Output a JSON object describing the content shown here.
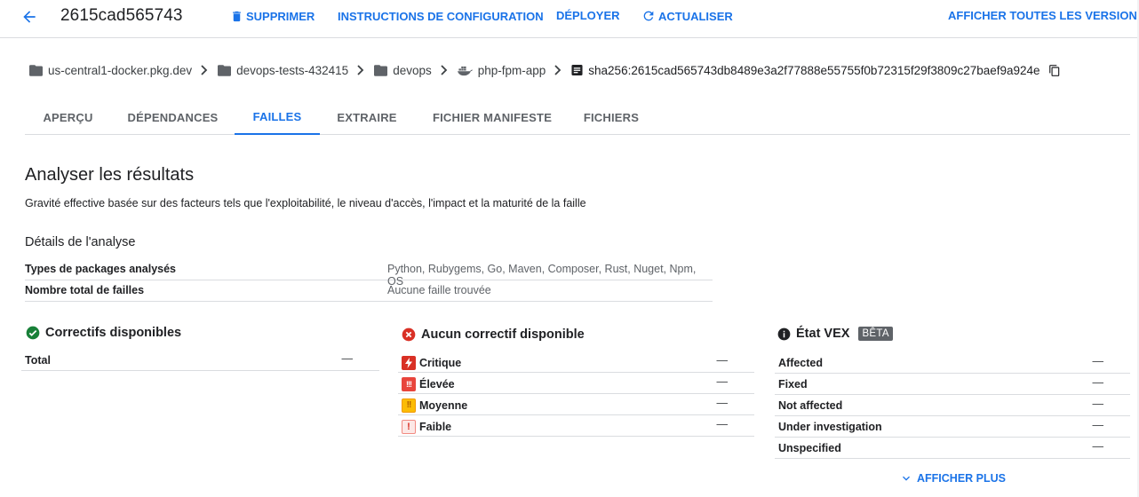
{
  "header": {
    "title": "2615cad565743",
    "delete_label": "SUPPRIMER",
    "setup_label": "INSTRUCTIONS DE CONFIGURATION",
    "deploy_label": "DÉPLOYER",
    "refresh_label": "ACTUALISER",
    "all_versions_label": "AFFICHER TOUTES LES VERSIONS",
    "accent_color": "#1a73e8"
  },
  "breadcrumb": {
    "items": [
      {
        "label": "us-central1-docker.pkg.dev",
        "icon": "folder-icon"
      },
      {
        "label": "devops-tests-432415",
        "icon": "folder-icon"
      },
      {
        "label": "devops",
        "icon": "folder-icon"
      },
      {
        "label": "php-fpm-app",
        "icon": "docker-icon"
      }
    ],
    "digest": "sha256:2615cad565743db8489e3a2f77888e55755f0b72315f29f3809c27baef9a924e"
  },
  "tabs": [
    {
      "label": "APERÇU",
      "active": false
    },
    {
      "label": "DÉPENDANCES",
      "active": false
    },
    {
      "label": "FAILLES",
      "active": true
    },
    {
      "label": "EXTRAIRE",
      "active": false
    },
    {
      "label": "FICHIER MANIFESTE",
      "active": false
    },
    {
      "label": "FICHIERS",
      "active": false
    }
  ],
  "analysis": {
    "title": "Analyser les résultats",
    "description": "Gravité effective basée sur des facteurs tels que l'exploitabilité, le niveau d'accès, l'impact et la maturité de la faille",
    "details_title": "Détails de l'analyse",
    "rows": [
      {
        "label": "Types de packages analysés",
        "value": "Python, Rubygems, Go, Maven, Composer, Rust, Nuget, Npm, OS"
      },
      {
        "label": "Nombre total de failles",
        "value": "Aucune faille trouvée"
      }
    ]
  },
  "fixes": {
    "title": "Correctifs disponibles",
    "rows": [
      {
        "label": "Total",
        "value": "—"
      }
    ]
  },
  "no_fix": {
    "title": "Aucun correctif disponible",
    "rows": [
      {
        "label": "Critique",
        "value": "—",
        "icon": "critical-icon",
        "color": "#d93025"
      },
      {
        "label": "Élevée",
        "value": "—",
        "icon": "high-icon",
        "color": "#e8453c"
      },
      {
        "label": "Moyenne",
        "value": "—",
        "icon": "medium-icon",
        "color": "#f29900"
      },
      {
        "label": "Faible",
        "value": "—",
        "icon": "low-icon",
        "color": "#d93025"
      }
    ]
  },
  "vex": {
    "title": "État VEX",
    "badge": "BÊTA",
    "rows": [
      {
        "label": "Affected",
        "value": "—"
      },
      {
        "label": "Fixed",
        "value": "—"
      },
      {
        "label": "Not affected",
        "value": "—"
      },
      {
        "label": "Under investigation",
        "value": "—"
      },
      {
        "label": "Unspecified",
        "value": "—"
      }
    ],
    "show_more_label": "AFFICHER PLUS"
  }
}
